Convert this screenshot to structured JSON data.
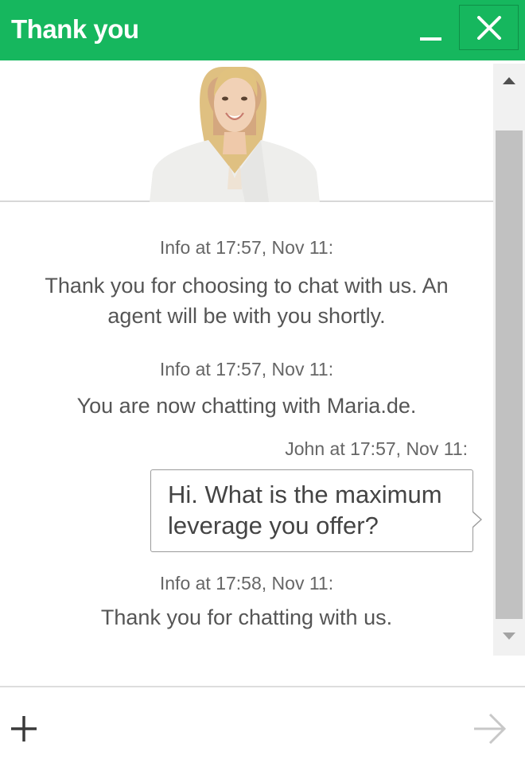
{
  "window": {
    "title": "Thank you",
    "accent_color": "#16b75e",
    "minimize_icon": "minimize-icon",
    "close_icon": "close-icon"
  },
  "agent": {
    "avatar": "agent-photo"
  },
  "messages": [
    {
      "type": "info",
      "header": "Info at 17:57, Nov 11:",
      "text": "Thank you for choosing to chat with us. An agent will be with you shortly."
    },
    {
      "type": "info",
      "header": "Info at 17:57, Nov 11:",
      "text": "You are now chatting with Maria.de."
    },
    {
      "type": "user",
      "header": "John at 17:57, Nov 11:",
      "text": "Hi. What is the maximum leverage you offer?"
    },
    {
      "type": "info",
      "header": "Info at 17:58, Nov 11:",
      "text": "Thank you for chatting with us."
    }
  ],
  "composer": {
    "attach_icon": "plus-icon",
    "send_icon": "arrow-right-icon"
  }
}
